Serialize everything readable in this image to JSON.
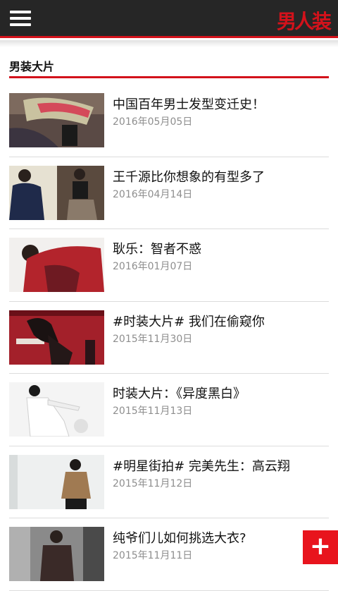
{
  "header": {
    "logo_text": "男人装",
    "menu_icon": "hamburger-menu-icon"
  },
  "section": {
    "title": "男装大片"
  },
  "articles": [
    {
      "title": "中国百年男士发型变迁史！",
      "date": "2016年05月05日"
    },
    {
      "title": "王千源比你想象的有型多了",
      "date": "2016年04月14日"
    },
    {
      "title": "耿乐：智者不惑",
      "date": "2016年01月07日"
    },
    {
      "title": "#时装大片# 我们在偷窥你",
      "date": "2015年11月30日"
    },
    {
      "title": "时装大片：《异度黑白》",
      "date": "2015年11月13日"
    },
    {
      "title": "#明星街拍# 完美先生：高云翔",
      "date": "2015年11月12日"
    },
    {
      "title": "纯爷们儿如何挑选大衣?",
      "date": "2015年11月11日"
    }
  ],
  "fab": {
    "label": "+"
  },
  "colors": {
    "accent": "#d3121b",
    "topbar": "#262626",
    "date": "#8e8e8e"
  }
}
